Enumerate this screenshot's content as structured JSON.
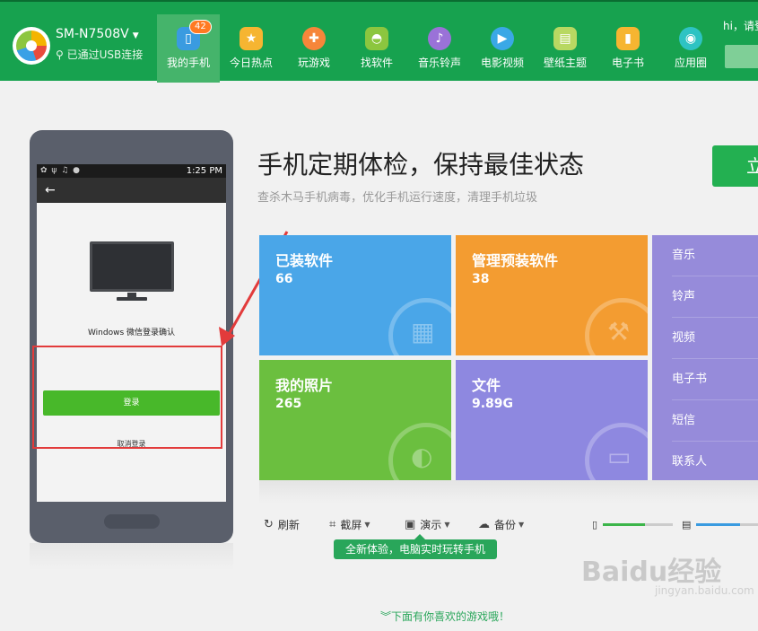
{
  "header": {
    "device_name": "SM-N7508V",
    "usb_status": "已通过USB连接",
    "greeting": "hi，请登",
    "nav": [
      {
        "label": "我的手机",
        "icon": "phone-icon",
        "badge": "42",
        "active": true,
        "color": "#3a9be0"
      },
      {
        "label": "今日热点",
        "icon": "star-icon",
        "color": "#f6b531"
      },
      {
        "label": "玩游戏",
        "icon": "gamepad-icon",
        "color": "#f6863a"
      },
      {
        "label": "找软件",
        "icon": "android-icon",
        "color": "#8cc63f"
      },
      {
        "label": "音乐铃声",
        "icon": "music-icon",
        "color": "#9a72d8"
      },
      {
        "label": "电影视频",
        "icon": "play-icon",
        "color": "#3aa8e6"
      },
      {
        "label": "壁纸主题",
        "icon": "wallpaper-icon",
        "color": "#b8d862"
      },
      {
        "label": "电子书",
        "icon": "book-icon",
        "color": "#f6b531"
      },
      {
        "label": "应用圈",
        "icon": "circle-icon",
        "color": "#2ec3c3"
      }
    ]
  },
  "phone": {
    "status_time": "1:25 PM",
    "confirm_text": "Windows 微信登录确认",
    "login_button": "登录",
    "cancel_link": "取消登录"
  },
  "main": {
    "headline": "手机定期体检，保持最佳状态",
    "subline": "查杀木马手机病毒，优化手机运行速度，清理手机垃圾",
    "check_button": "立",
    "tiles": [
      {
        "title": "已装软件",
        "value": "66"
      },
      {
        "title": "管理预装软件",
        "value": "38"
      },
      {
        "title": "我的照片",
        "value": "265"
      },
      {
        "title": "文件",
        "value": "9.89G"
      }
    ],
    "side_items": [
      "音乐",
      "铃声",
      "视频",
      "电子书",
      "短信",
      "联系人"
    ]
  },
  "toolbar": {
    "refresh": "刷新",
    "screenshot": "截屏",
    "demo": "演示",
    "backup": "备份",
    "tooltip": "全新体验，电脑实时玩转手机"
  },
  "storage": {
    "phone_fill": 0.6,
    "sd_fill": 0.7
  },
  "bottom_hint": "下面有你喜欢的游戏哦！",
  "watermark": {
    "brand": "Baidu经验",
    "url": "jingyan.baidu.com"
  }
}
